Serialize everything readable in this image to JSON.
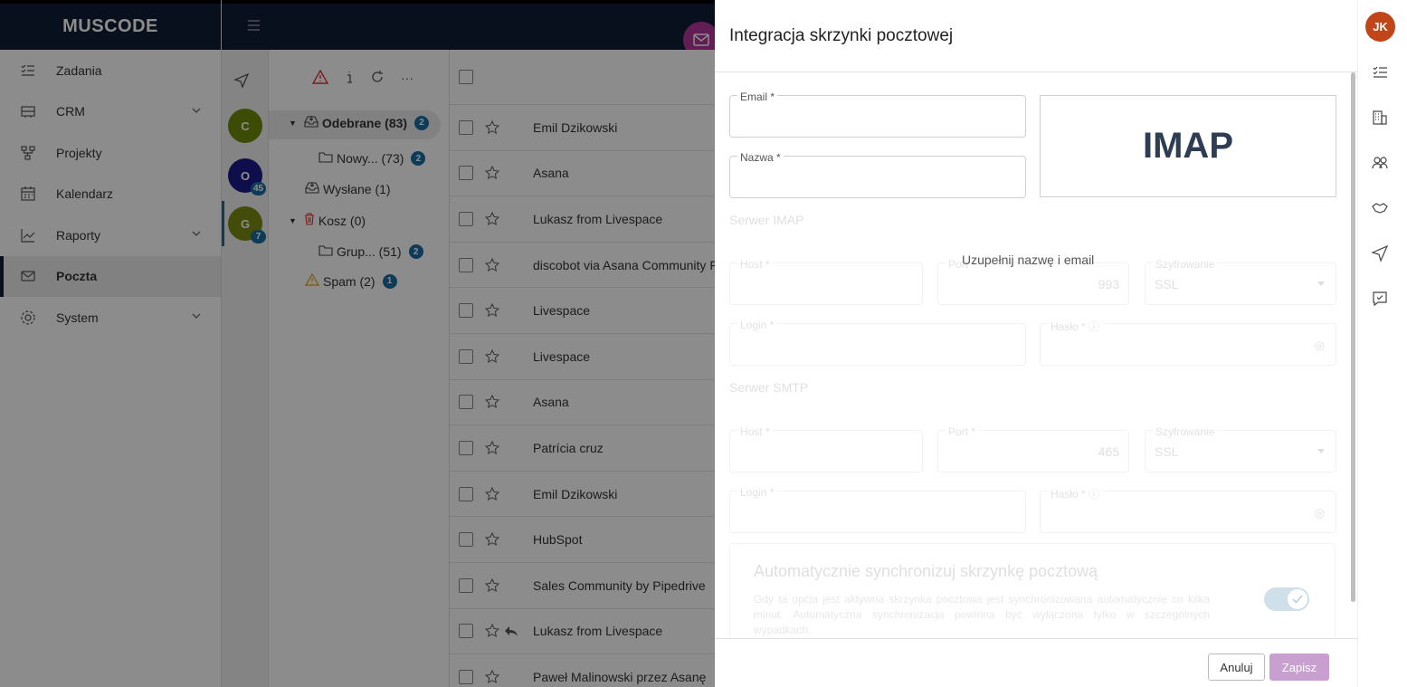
{
  "app": {
    "logo": "MUSCODE"
  },
  "sidebar": {
    "items": [
      {
        "label": "Zadania",
        "icon": "tasks-icon",
        "chevron": false
      },
      {
        "label": "CRM",
        "icon": "crm-icon",
        "chevron": true
      },
      {
        "label": "Projekty",
        "icon": "projects-icon",
        "chevron": false
      },
      {
        "label": "Kalendarz",
        "icon": "calendar-icon",
        "chevron": false
      },
      {
        "label": "Raporty",
        "icon": "reports-icon",
        "chevron": true
      },
      {
        "label": "Poczta",
        "icon": "mail-icon",
        "chevron": false,
        "active": true
      },
      {
        "label": "System",
        "icon": "settings-icon",
        "chevron": true
      }
    ]
  },
  "accounts": [
    {
      "letter": "C",
      "color": "#6e8a0a",
      "count": ""
    },
    {
      "letter": "O",
      "color": "#1a1a8a",
      "count": "45"
    },
    {
      "letter": "G",
      "color": "#7a8a10",
      "count": "7"
    }
  ],
  "folders": [
    {
      "label": "Odebrane (83)",
      "badge": "2"
    },
    {
      "label": "Nowy... (73)",
      "badge": "2"
    },
    {
      "label": "Wysłane (1)",
      "badge": ""
    },
    {
      "label": "Kosz (0)",
      "badge": ""
    },
    {
      "label": "Grup... (51)",
      "badge": "2"
    },
    {
      "label": "Spam (2)",
      "badge": "1"
    }
  ],
  "mails": [
    {
      "sender": "Emil Dzikowski"
    },
    {
      "sender": "Asana"
    },
    {
      "sender": "Lukasz from Livespace"
    },
    {
      "sender": "discobot via Asana Community Fo"
    },
    {
      "sender": "Livespace"
    },
    {
      "sender": "Livespace"
    },
    {
      "sender": "Asana"
    },
    {
      "sender": "Patrícia cruz"
    },
    {
      "sender": "Emil Dzikowski"
    },
    {
      "sender": "HubSpot"
    },
    {
      "sender": "Sales Community by Pipedrive"
    },
    {
      "sender": "Lukasz from Livespace",
      "replied": true
    },
    {
      "sender": "Paweł Malinowski przez Asanę"
    }
  ],
  "panel": {
    "title": "Integracja skrzynki pocztowej",
    "email_label": "Email *",
    "email_value": "",
    "name_label": "Nazwa *",
    "name_value": "",
    "protocol": "IMAP",
    "hint": "Uzupełnij nazwę i email",
    "imap": {
      "section": "Serwer IMAP",
      "host_label": "Host *",
      "port_label": "Port *",
      "port_value": "993",
      "enc_label": "Szyfrowanie",
      "enc_value": "SSL",
      "login_label": "Login *",
      "pass_label": "Hasło *"
    },
    "smtp": {
      "section": "Serwer SMTP",
      "host_label": "Host *",
      "port_label": "Port *",
      "port_value": "465",
      "enc_label": "Szyfrowanie",
      "enc_value": "SSL",
      "login_label": "Login *",
      "pass_label": "Hasło *"
    },
    "sync": {
      "title": "Automatycznie synchronizuj skrzynkę pocztową",
      "desc": "Gdy ta opcja jest aktywna skrzynka pocztowa jest synchronizowana automatycznie co kilka minut. Automatyczna synchronizacja powinna być wyłączona tylko w szczególnych wypadkach.",
      "enabled": true
    },
    "cancel_label": "Anuluj",
    "save_label": "Zapisz"
  },
  "user": {
    "initials": "JK"
  },
  "colors": {
    "navy": "#0f1d36",
    "accent": "#b3359b",
    "badge": "#1a6ea1"
  }
}
